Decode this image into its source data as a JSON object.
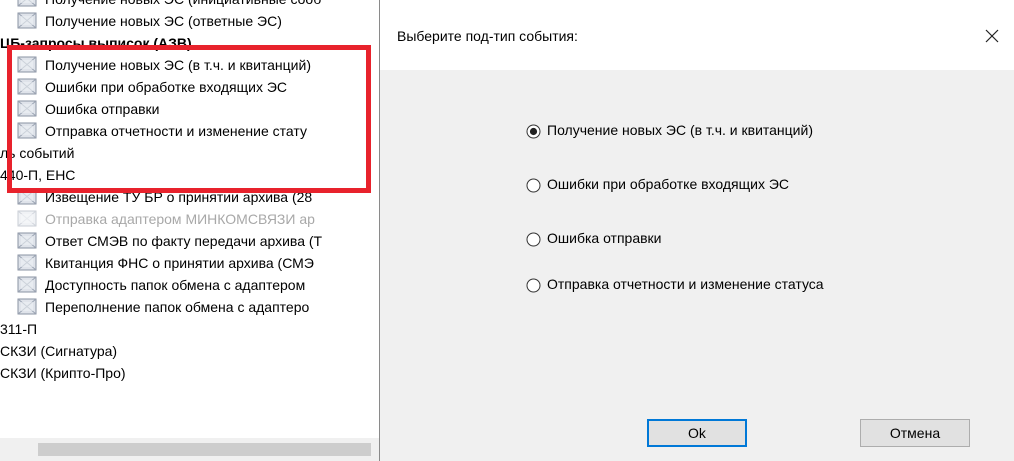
{
  "tree": {
    "rows": [
      {
        "label": "Получение новых ЭС (инициативные сооб",
        "indent": true,
        "icon": "leaf-icon",
        "bold": false,
        "disabled": false
      },
      {
        "label": "Получение новых ЭС (ответные ЭС)",
        "indent": true,
        "icon": "leaf-icon",
        "bold": false,
        "disabled": false
      },
      {
        "label": "ЦБ-запросы выписок (АЗВ)",
        "indent": false,
        "icon": "",
        "bold": true,
        "disabled": false
      },
      {
        "label": "Получение новых ЭС (в т.ч. и квитанций)",
        "indent": true,
        "icon": "leaf-icon",
        "bold": false,
        "disabled": false
      },
      {
        "label": "Ошибки при обработке входящих ЭС",
        "indent": true,
        "icon": "leaf-icon",
        "bold": false,
        "disabled": false
      },
      {
        "label": "Ошибка отправки",
        "indent": true,
        "icon": "leaf-icon",
        "bold": false,
        "disabled": false
      },
      {
        "label": "Отправка отчетности и изменение стату",
        "indent": true,
        "icon": "leaf-icon",
        "bold": false,
        "disabled": false
      },
      {
        "label": "ль событий",
        "indent": false,
        "icon": "",
        "bold": false,
        "disabled": false
      },
      {
        "label": "440-П, ЕНС",
        "indent": false,
        "icon": "",
        "bold": false,
        "disabled": false
      },
      {
        "label": "Извещение ТУ БР о принятии архива (28",
        "indent": true,
        "icon": "leaf-icon",
        "bold": false,
        "disabled": false
      },
      {
        "label": "Отправка адаптером МИНКОМСВЯЗИ ар",
        "indent": true,
        "icon": "leaf-icon",
        "bold": false,
        "disabled": true
      },
      {
        "label": "Ответ СМЭВ по факту передачи архива (Т",
        "indent": true,
        "icon": "leaf-icon",
        "bold": false,
        "disabled": false
      },
      {
        "label": "Квитанция ФНС о принятии архива (СМЭ",
        "indent": true,
        "icon": "leaf-icon",
        "bold": false,
        "disabled": false
      },
      {
        "label": "Доступность папок обмена с адаптером",
        "indent": true,
        "icon": "leaf-icon",
        "bold": false,
        "disabled": false
      },
      {
        "label": "Переполнение папок обмена с адаптеро",
        "indent": true,
        "icon": "leaf-icon",
        "bold": false,
        "disabled": false
      },
      {
        "label": "311-П",
        "indent": false,
        "icon": "",
        "bold": false,
        "disabled": false
      },
      {
        "label": "СКЗИ (Сигнатура)",
        "indent": false,
        "icon": "",
        "bold": false,
        "disabled": false
      },
      {
        "label": "СКЗИ (Крипто-Про)",
        "indent": false,
        "icon": "",
        "bold": false,
        "disabled": false
      }
    ],
    "highlight_color": "#e8222c"
  },
  "dialog": {
    "title": "Выберите под-тип события:",
    "close_icon": "close-icon",
    "options": [
      {
        "label": "Получение новых ЭС (в т.ч. и квитанций)",
        "selected": true
      },
      {
        "label": "Ошибки при обработке входящих ЭС",
        "selected": false
      },
      {
        "label": "Ошибка отправки",
        "selected": false
      },
      {
        "label": "Отправка отчетности и изменение статуса",
        "selected": false
      }
    ],
    "ok_label": "Ok",
    "cancel_label": "Отмена",
    "accent_color": "#0078d7"
  }
}
